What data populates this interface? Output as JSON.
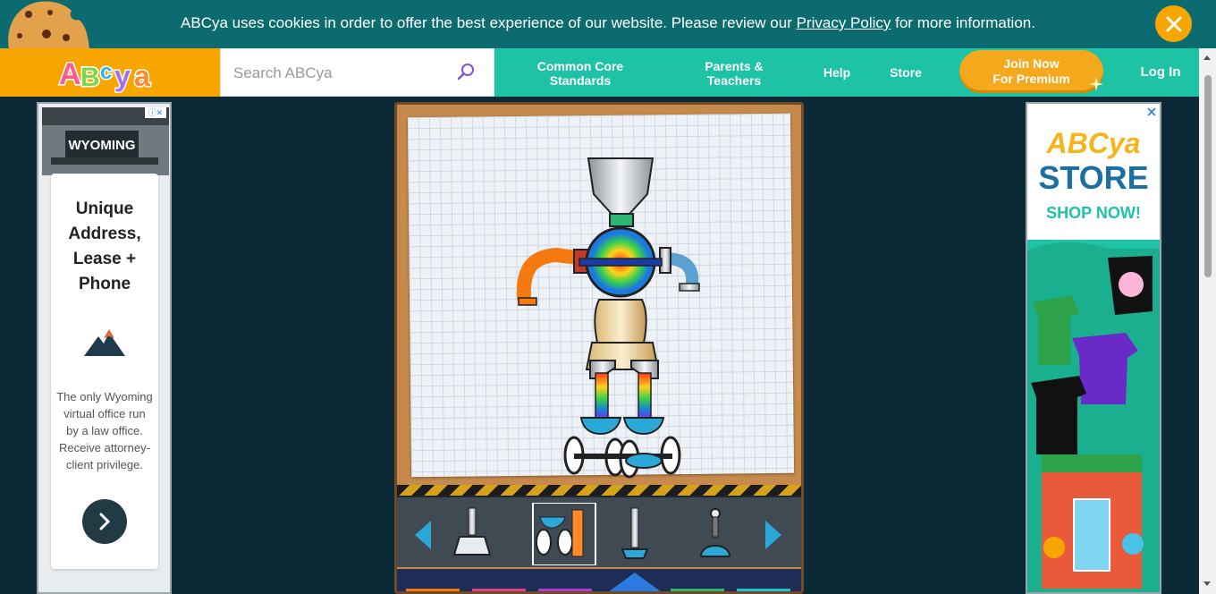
{
  "cookie_banner": {
    "text_before": "ABCya uses cookies in order to offer the best experience of our website. Please review our ",
    "link_text": "Privacy Policy",
    "text_after": " for more information."
  },
  "header": {
    "logo_text": "ABCya",
    "search": {
      "placeholder": "Search ABCya",
      "value": ""
    },
    "nav": {
      "common_core_line1": "Common Core",
      "common_core_line2": "Standards",
      "parents_line1": "Parents &",
      "parents_line2": "Teachers",
      "help": "Help",
      "store": "Store",
      "premium_line1": "Join Now",
      "premium_line2": "For Premium",
      "login": "Log In"
    }
  },
  "left_ad": {
    "billboard_text": "WYOMING",
    "headline_lines": [
      "Unique",
      "Address,",
      "Lease +",
      "Phone"
    ],
    "body_lines": [
      "The only Wyoming",
      "virtual office run",
      "by a law office.",
      "Receive attorney-",
      "client privilege."
    ]
  },
  "right_ad": {
    "logo": "ABCya",
    "title": "STORE",
    "cta": "SHOP NOW!"
  },
  "colors": {
    "banner": "#0b6b6e",
    "nav": "#1ec2a4",
    "accent_orange": "#f7a600",
    "page_bg": "#0c2a35"
  }
}
